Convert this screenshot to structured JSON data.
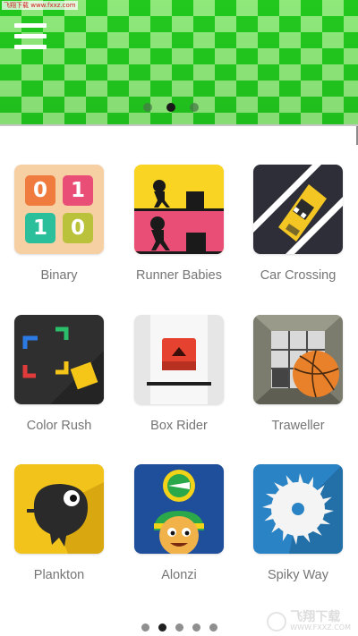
{
  "watermark_top": "飞翔下载 www.fxxz.com",
  "banner": {
    "page_count": 3,
    "active_page": 2
  },
  "apps": [
    {
      "label": "Binary",
      "icon": "binary-icon",
      "digits": [
        "0",
        "1",
        "1",
        "0"
      ]
    },
    {
      "label": "Runner Babies",
      "icon": "runner-babies-icon"
    },
    {
      "label": "Car Crossing",
      "icon": "car-crossing-icon"
    },
    {
      "label": "Color Rush",
      "icon": "color-rush-icon"
    },
    {
      "label": "Box Rider",
      "icon": "box-rider-icon"
    },
    {
      "label": "Traweller",
      "icon": "traweller-icon"
    },
    {
      "label": "Plankton",
      "icon": "plankton-icon"
    },
    {
      "label": "Alonzi",
      "icon": "alonzi-icon"
    },
    {
      "label": "Spiky Way",
      "icon": "spiky-way-icon"
    }
  ],
  "pager": {
    "page_count": 5,
    "active_page": 2
  },
  "watermark_bottom": {
    "main": "飞翔下载",
    "sub": "WWW.FXXZ.COM"
  },
  "colors": {
    "banner_green_dark": "#22c81e",
    "banner_green_light": "#8ee87a",
    "label_gray": "#757575"
  }
}
